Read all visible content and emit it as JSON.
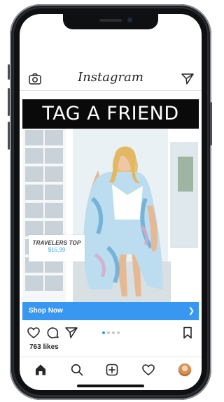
{
  "header": {
    "logo_text": "Instagram",
    "camera_icon": "camera-icon",
    "direct_icon": "paper-plane-icon"
  },
  "post": {
    "banner_text": "TAG A FRIEND",
    "product_tag": {
      "name": "TRAVELERS TOP",
      "price": "$16.99"
    },
    "shop_now_label": "Shop Now",
    "shop_now_icon": "chevron-right-icon",
    "carousel": {
      "count": 4,
      "active_index": 0
    },
    "likes_text": "763 likes"
  },
  "actions": [
    "heart-icon",
    "comment-icon",
    "share-icon",
    "bookmark-icon"
  ],
  "bottom_nav": [
    "home-icon",
    "search-icon",
    "add-icon",
    "activity-heart-icon",
    "profile-avatar"
  ],
  "colors": {
    "accent": "#3897f0",
    "banner_bg": "#0a0a0a",
    "price": "#3aa6e8"
  }
}
